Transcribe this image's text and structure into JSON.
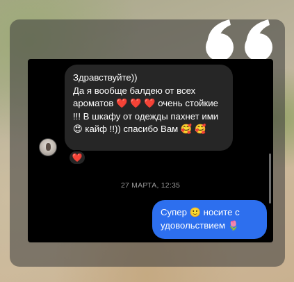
{
  "colors": {
    "chat_background": "#000000",
    "incoming_bubble": "#262626",
    "outgoing_bubble": "#2d6fee",
    "timestamp_text": "#9a9a9a",
    "reaction_heart": "#ff2d3a"
  },
  "decor": {
    "quote_icon": "double-quote-icon"
  },
  "chat": {
    "avatar_icon": "user-avatar",
    "incoming_message": "Здравствуйте))\nДа я вообще балдею от всех ароматов ❤️ ❤️ ❤️ очень стойкие !!! В шкафу от одежды пахнет ими 😍 кайф !!)) спасибо Вам 🥰 🥰",
    "reaction": "❤️",
    "timestamp": "27 МАРТА, 12:35",
    "outgoing_message": "Супер 🙂 носите с удовольствием 🌷"
  }
}
